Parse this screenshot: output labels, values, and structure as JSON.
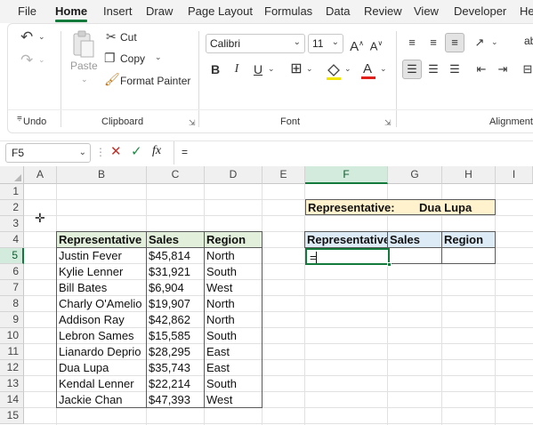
{
  "menu": {
    "tabs": [
      "File",
      "Home",
      "Insert",
      "Draw",
      "Page Layout",
      "Formulas",
      "Data",
      "Review",
      "View",
      "Developer",
      "He"
    ],
    "active": "Home"
  },
  "ribbon": {
    "undo_group": {
      "label": "Undo"
    },
    "clipboard": {
      "paste": "Paste",
      "cut": "Cut",
      "copy": "Copy",
      "format_painter": "Format Painter",
      "label": "Clipboard"
    },
    "font": {
      "name": "Calibri",
      "size": "11",
      "bold": "B",
      "italic": "I",
      "underline": "U",
      "label": "Font"
    },
    "alignment": {
      "label": "Alignment",
      "wrap_prefix": "ab"
    }
  },
  "formula_bar": {
    "name_box": "F5",
    "fx": "fx",
    "content": "="
  },
  "columns": [
    "A",
    "B",
    "C",
    "D",
    "E",
    "F",
    "G",
    "H",
    "I"
  ],
  "rows": [
    "1",
    "2",
    "3",
    "4",
    "5",
    "6",
    "7",
    "8",
    "9",
    "10",
    "11",
    "12",
    "13",
    "14",
    "15"
  ],
  "table": {
    "headers": [
      "Representative",
      "Sales",
      "Region"
    ],
    "rows": [
      [
        "Justin Fever",
        "$45,814",
        "North"
      ],
      [
        "Kylie Lenner",
        "$31,921",
        "South"
      ],
      [
        "Bill Bates",
        "$6,904",
        "West"
      ],
      [
        "Charly O'Amelio",
        "$19,907",
        "North"
      ],
      [
        "Addison Ray",
        "$42,862",
        "North"
      ],
      [
        "Lebron Sames",
        "$15,585",
        "South"
      ],
      [
        "Lianardo Deprio",
        "$28,295",
        "East"
      ],
      [
        "Dua Lupa",
        "$35,743",
        "East"
      ],
      [
        "Kendal Lenner",
        "$22,214",
        "South"
      ],
      [
        "Jackie Chan",
        "$47,393",
        "West"
      ]
    ]
  },
  "lookup": {
    "rep_label": "Representative:",
    "rep_value": "Dua Lupa",
    "headers": [
      "Representative",
      "Sales",
      "Region"
    ],
    "active_entry": "="
  },
  "colors": {
    "accent": "#137a3c",
    "table_header": "#e2efda",
    "lookup_header": "#ddebf7",
    "rep_fill": "#fff2cc"
  }
}
